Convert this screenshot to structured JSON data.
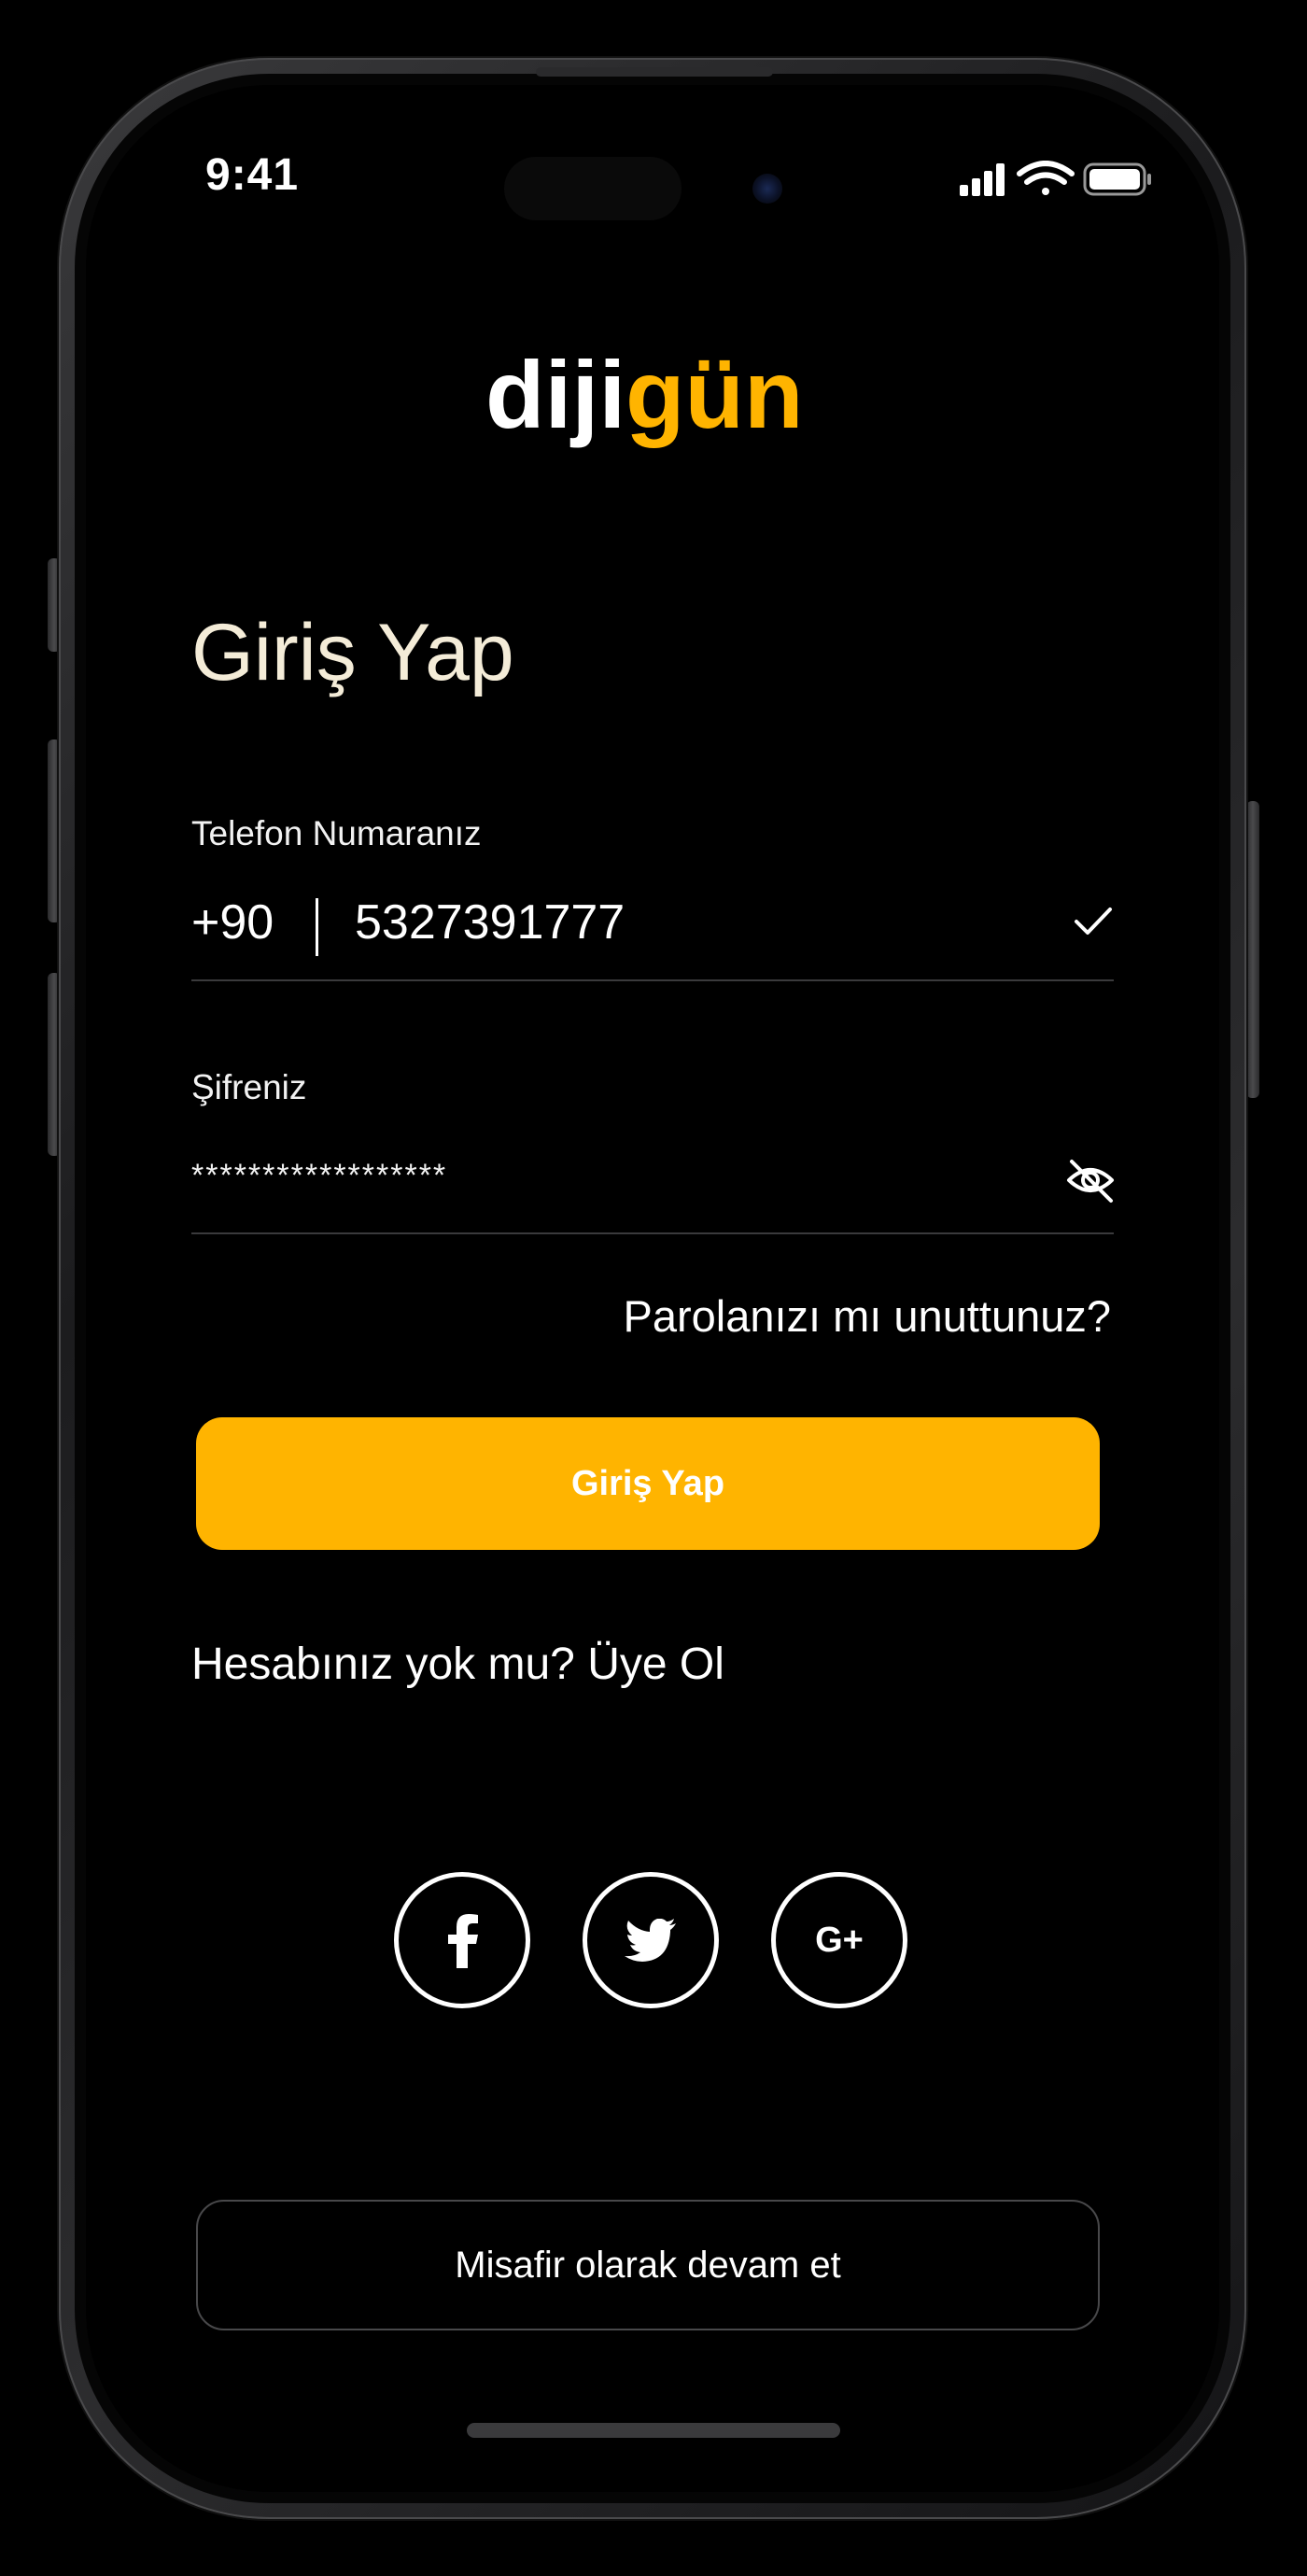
{
  "status_bar": {
    "time": "9:41"
  },
  "brand": {
    "logo_text_part1": "diji",
    "logo_text_part2": "gün",
    "accent_color": "#ffb400"
  },
  "login": {
    "title": "Giriş Yap",
    "phone_label": "Telefon Numaranız",
    "country_code": "+90",
    "phone_value": "5327391777",
    "password_label": "Şifreniz",
    "password_value": "******************",
    "forgot_link": "Parolanızı mı unuttunuz?",
    "submit_label": "Giriş Yap",
    "signup_text": "Hesabınız yok mu? Üye Ol"
  },
  "social": {
    "items": [
      {
        "name": "facebook",
        "icon": "facebook-icon"
      },
      {
        "name": "twitter",
        "icon": "twitter-icon"
      },
      {
        "name": "google-plus",
        "icon": "google-plus-icon",
        "label": "G+"
      }
    ]
  },
  "guest": {
    "label": "Misafir olarak devam et"
  },
  "icons": {
    "check": "check-icon",
    "password_toggle": "eye-off-icon"
  }
}
